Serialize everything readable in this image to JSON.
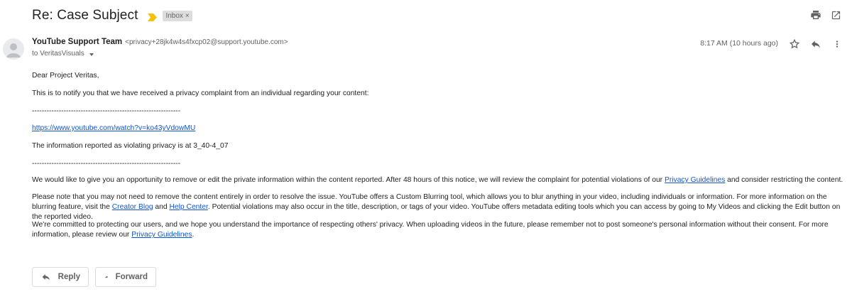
{
  "header": {
    "subject": "Re: Case Subject",
    "label": "Inbox",
    "label_remove": "×",
    "important_color": "#f4c20d",
    "print_icon": "print-icon",
    "popout_icon": "open-in-new-window-icon"
  },
  "message": {
    "sender_name": "YouTube Support Team",
    "sender_email": "<privacy+28jk4w4s4fxcp02@support.youtube.com>",
    "to_line": "to VeritasVisuals",
    "time": "8:17 AM (10 hours ago)",
    "star_icon": "star-icon",
    "reply_icon": "reply-icon",
    "more_icon": "more-vert-icon"
  },
  "body": {
    "greeting": "Dear Project Veritas,",
    "intro": "This is to notify you that we have received a privacy complaint from an individual regarding your content:",
    "divider": "-------------------------------------------------------------",
    "video_link": "https://www.youtube.com/watch?v=ko43yVdowMU",
    "reported_at": "The information reported as violating privacy is at 3_40-4_07",
    "p1_a": "We would like to give you an opportunity to remove or edit the private information within the content reported. After 48 hours of this notice, we will review the complaint for potential violations of our ",
    "p1_link": "Privacy Guidelines",
    "p1_b": " and consider restricting the content.",
    "p2_a": "Please note that you may not need to remove the content entirely in order to resolve the issue. YouTube offers a Custom Blurring tool, which allows you to blur anything in your video, including individuals or information. For more information on the blurring feature, visit the ",
    "p2_link1": "Creator Blog",
    "p2_mid": " and ",
    "p2_link2": "Help Center",
    "p2_b": ". Potential violations may also occur in the title, description, or tags of your video. YouTube offers metadata editing tools which you can access by going to My Videos and clicking the Edit button on the reported video.",
    "p3_a": "We're committed to protecting our users, and we hope you understand the importance of respecting others' privacy. When uploading videos in the future, please remember not to post someone's personal information without their consent. For more information, please review our ",
    "p3_link": "Privacy Guidelines",
    "p3_b": "."
  },
  "actions": {
    "reply_label": "Reply",
    "forward_label": "Forward"
  }
}
